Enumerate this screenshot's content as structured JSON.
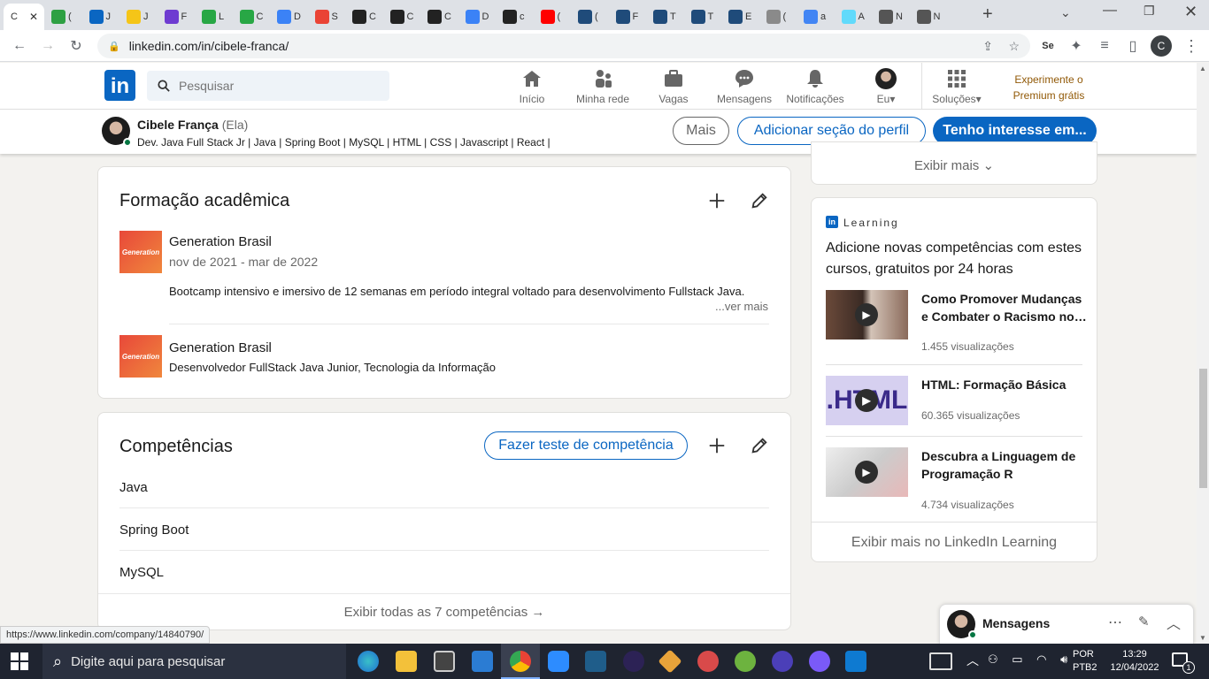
{
  "browser": {
    "tabs": [
      {
        "short": "C",
        "color": "#0a66c2",
        "active": true
      },
      {
        "short": "(",
        "color": "#2ea043"
      },
      {
        "short": "J",
        "color": "#0a66c2"
      },
      {
        "short": "J",
        "color": "#f5c518"
      },
      {
        "short": "F",
        "color": "#6e3bd1"
      },
      {
        "short": "L",
        "color": "#28a745"
      },
      {
        "short": "C",
        "color": "#28a745"
      },
      {
        "short": "D",
        "color": "#3b82f6"
      },
      {
        "short": "S",
        "color": "#ea4335"
      },
      {
        "short": "C",
        "color": "#222222"
      },
      {
        "short": "C",
        "color": "#222222"
      },
      {
        "short": "C",
        "color": "#222222"
      },
      {
        "short": "D",
        "color": "#3b82f6"
      },
      {
        "short": "c",
        "color": "#222222"
      },
      {
        "short": "(",
        "color": "#ff0000"
      },
      {
        "short": "(",
        "color": "#1f4b7a"
      },
      {
        "short": "F",
        "color": "#1f4b7a"
      },
      {
        "short": "T",
        "color": "#1f4b7a"
      },
      {
        "short": "T",
        "color": "#1f4b7a"
      },
      {
        "short": "E",
        "color": "#1f4b7a"
      },
      {
        "short": "(",
        "color": "#8a8a8a"
      },
      {
        "short": "a",
        "color": "#4285f4"
      },
      {
        "short": "A",
        "color": "#61dafb"
      },
      {
        "short": "N",
        "color": "#555555"
      },
      {
        "short": "N",
        "color": "#555555"
      }
    ],
    "new_tab": "+",
    "url": "linkedin.com/in/cibele-franca/",
    "profile_initial": "C",
    "status_url": "https://www.linkedin.com/company/14840790/"
  },
  "linkedin": {
    "logo": "in",
    "search_placeholder": "Pesquisar",
    "nav": [
      {
        "label": "Início",
        "icon": "home-icon"
      },
      {
        "label": "Minha rede",
        "icon": "network-icon"
      },
      {
        "label": "Vagas",
        "icon": "jobs-icon"
      },
      {
        "label": "Mensagens",
        "icon": "messages-icon"
      },
      {
        "label": "Notificações",
        "icon": "bell-icon"
      },
      {
        "label": "Eu",
        "icon": "avatar"
      },
      {
        "label": "Soluções",
        "icon": "grid-icon"
      }
    ],
    "premium_line1": "Experimente o",
    "premium_line2": "Premium grátis"
  },
  "profile_bar": {
    "name": "Cibele França",
    "pronoun": "(Ela)",
    "headline": "Dev. Java Full Stack Jr | Java | Spring Boot | MySQL | HTML | CSS | Javascript | React |",
    "more_button": "Mais",
    "add_section_button": "Adicionar seção do perfil",
    "interest_button": "Tenho interesse em..."
  },
  "education": {
    "title": "Formação acadêmica",
    "logo_text": "Generation",
    "items": [
      {
        "school": "Generation Brasil",
        "dates": "nov de 2021 - mar de 2022",
        "description": "Bootcamp intensivo e imersivo de 12 semanas em período integral voltado para desenvolvimento Fullstack Java.",
        "see_more": "...ver mais"
      },
      {
        "school": "Generation Brasil",
        "subtitle": "Desenvolvedor FullStack Java Junior, Tecnologia da Informação"
      }
    ]
  },
  "skills": {
    "title": "Competências",
    "test_button": "Fazer teste de competência",
    "items": [
      "Java",
      "Spring Boot",
      "MySQL"
    ],
    "show_all": "Exibir todas as 7 competências →"
  },
  "sidebar": {
    "show_more": "Exibir mais",
    "learning_label": "Learning",
    "learning_title": "Adicione novas competências com estes cursos, gratuitos por 24 horas",
    "courses": [
      {
        "title": "Como Promover Mudanças e Combater o Racismo no…",
        "views": "1.455 visualizações"
      },
      {
        "title": "HTML: Formação Básica",
        "views": "60.365 visualizações"
      },
      {
        "title": "Descubra a Linguagem de Programação R",
        "views": "4.734 visualizações"
      }
    ],
    "learning_footer": "Exibir mais no LinkedIn Learning"
  },
  "messaging": {
    "label": "Mensagens"
  },
  "taskbar": {
    "search_placeholder": "Digite aqui para pesquisar",
    "lang1": "POR",
    "lang2": "PTB2",
    "time": "13:29",
    "date": "12/04/2022",
    "notif_count": "1"
  },
  "colors": {
    "brand": "#0a66c2",
    "bg": "#f3f2ef"
  }
}
